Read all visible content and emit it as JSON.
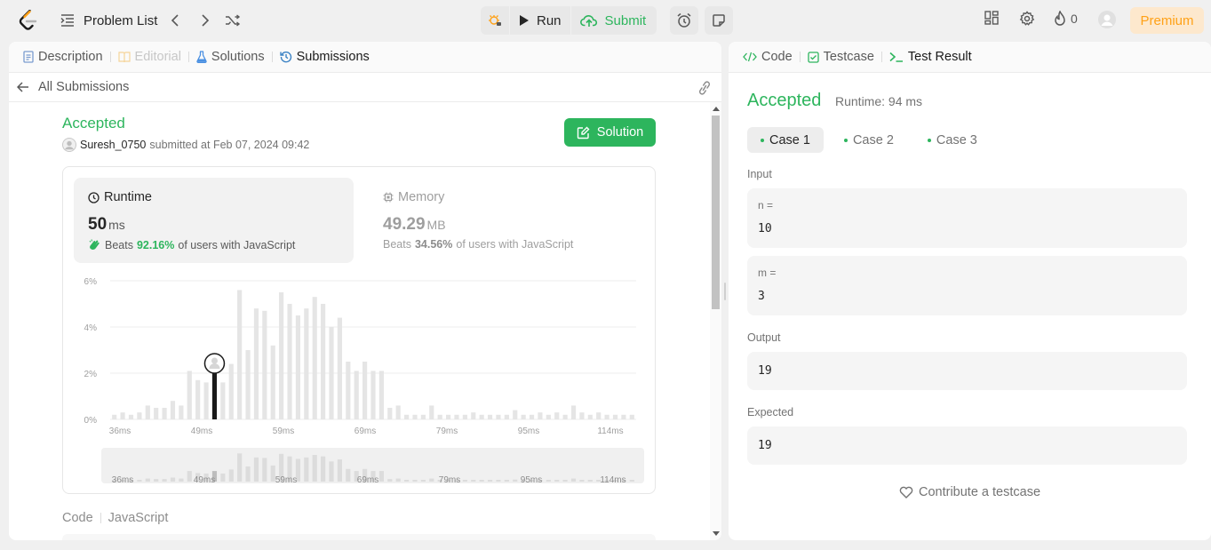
{
  "nav": {
    "problem_list": "Problem List",
    "run": "Run",
    "submit": "Submit",
    "streak": "0",
    "premium": "Premium"
  },
  "left_tabs": [
    {
      "label": "Description",
      "icon": "description-icon",
      "state": "normal"
    },
    {
      "label": "Editorial",
      "icon": "editorial-icon",
      "state": "disabled"
    },
    {
      "label": "Solutions",
      "icon": "flask-icon",
      "state": "normal"
    },
    {
      "label": "Submissions",
      "icon": "history-icon",
      "state": "active"
    }
  ],
  "submission": {
    "back_label": "All Submissions",
    "status": "Accepted",
    "username": "Suresh_0750",
    "submitted_text": "submitted at Feb 07, 2024 09:42",
    "solution_button": "Solution",
    "runtime": {
      "title": "Runtime",
      "value": "50",
      "unit": "ms",
      "beats_label": "Beats",
      "beats_pct": "92.16%",
      "beats_suffix": "of users with JavaScript"
    },
    "memory": {
      "title": "Memory",
      "value": "49.29",
      "unit": "MB",
      "beats_label": "Beats",
      "beats_pct": "34.56%",
      "beats_suffix": "of users with JavaScript"
    },
    "code_label": "Code",
    "language": "JavaScript"
  },
  "chart_data": {
    "type": "bar",
    "y_ticks": [
      "6%",
      "4%",
      "2%",
      "0%"
    ],
    "x_ticks": [
      "36ms",
      "49ms",
      "59ms",
      "69ms",
      "79ms",
      "95ms",
      "114ms"
    ],
    "ylim": [
      0,
      6
    ],
    "values": [
      0.2,
      0.3,
      0.2,
      0.3,
      0.6,
      0.5,
      0.5,
      0.8,
      0.6,
      2.1,
      1.7,
      1.6,
      2.1,
      1.6,
      2.4,
      5.6,
      3.0,
      4.8,
      4.7,
      3.2,
      5.5,
      5.0,
      4.5,
      4.8,
      5.3,
      5.0,
      4.0,
      4.4,
      2.5,
      2.1,
      2.5,
      2.1,
      2.1,
      0.5,
      0.6,
      0.2,
      0.2,
      0.2,
      0.6,
      0.2,
      0.2,
      0.2,
      0.2,
      0.3,
      0.2,
      0.2,
      0.2,
      0.2,
      0.4,
      0.2,
      0.2,
      0.3,
      0.2,
      0.3,
      0.2,
      0.6,
      0.3,
      0.2,
      0.3,
      0.2,
      0.2,
      0.2,
      0.2
    ],
    "highlight_index": 12,
    "grid": true
  },
  "right_tabs": [
    {
      "label": "Code",
      "icon": "code-icon",
      "state": "normal"
    },
    {
      "label": "Testcase",
      "icon": "checkbox-icon",
      "state": "normal"
    },
    {
      "label": "Test Result",
      "icon": "terminal-icon",
      "state": "active"
    }
  ],
  "result": {
    "status": "Accepted",
    "runtime": "Runtime: 94 ms",
    "cases": [
      "Case 1",
      "Case 2",
      "Case 3"
    ],
    "input_label": "Input",
    "inputs": [
      {
        "name": "n =",
        "value": "10"
      },
      {
        "name": "m =",
        "value": "3"
      }
    ],
    "output_label": "Output",
    "output": "19",
    "expected_label": "Expected",
    "expected": "19",
    "contribute": "Contribute a testcase"
  },
  "colors": {
    "accent_green": "#2db55d",
    "premium_orange": "#ffa116",
    "logo_orange": "#ffa116"
  }
}
